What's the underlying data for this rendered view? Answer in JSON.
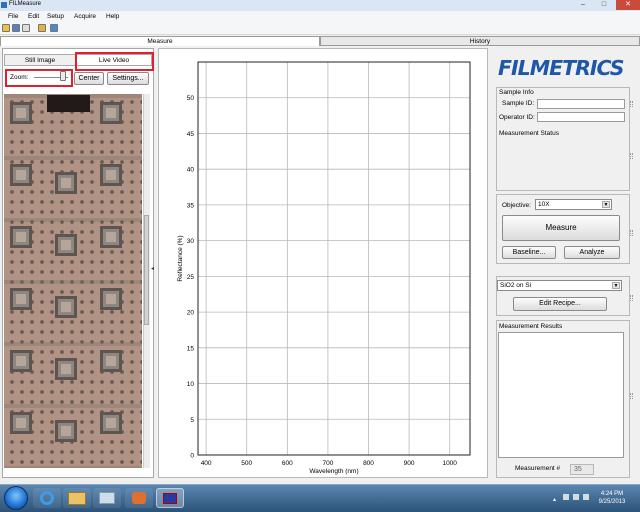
{
  "window": {
    "title": "FILMeasure",
    "minimize": "–",
    "maximize": "□",
    "close": "✕"
  },
  "menu": [
    "File",
    "Edit",
    "Setup",
    "Acquire",
    "Help"
  ],
  "toolbar_icons": [
    "open-icon",
    "save-icon",
    "print-icon",
    "image-icon",
    "camera-icon"
  ],
  "tabs": {
    "measure": "Measure",
    "history": "History"
  },
  "left": {
    "still_tab": "Still Image",
    "live_tab": "Live Video",
    "zoom_label": "Zoom:",
    "zoom_level": 0.85,
    "center_button": "Center",
    "settings_button": "Settings...",
    "highlight_color": "#e0202c"
  },
  "chart_data": {
    "type": "line",
    "xlabel": "Wavelength (nm)",
    "ylabel": "Reflectance (%)",
    "xlim": [
      380,
      1050
    ],
    "ylim": [
      0,
      55
    ],
    "xticks": [
      400,
      500,
      600,
      700,
      800,
      900,
      1000
    ],
    "yticks": [
      0,
      5,
      10,
      15,
      20,
      25,
      30,
      35,
      40,
      45,
      50
    ],
    "grid": true,
    "series": []
  },
  "right": {
    "logo": "FILMETRICS",
    "sample_info_title": "Sample Info",
    "sample_id_label": "Sample ID:",
    "sample_id_value": "",
    "operator_id_label": "Operator ID:",
    "operator_id_value": "",
    "measurement_status_label": "Measurement Status",
    "objective_label": "Objective:",
    "objective_value": "10X",
    "measure_button": "Measure",
    "baseline_button": "Baseline...",
    "analyze_button": "Analyze",
    "recipe_value": "SiO2 on Si",
    "edit_recipe_button": "Edit Recipe...",
    "results_label": "Measurement Results",
    "measurement_num_label": "Measurement #",
    "measurement_num_value": "35"
  },
  "taskbar": {
    "time": "4:24 PM",
    "date": "9/25/2013"
  }
}
